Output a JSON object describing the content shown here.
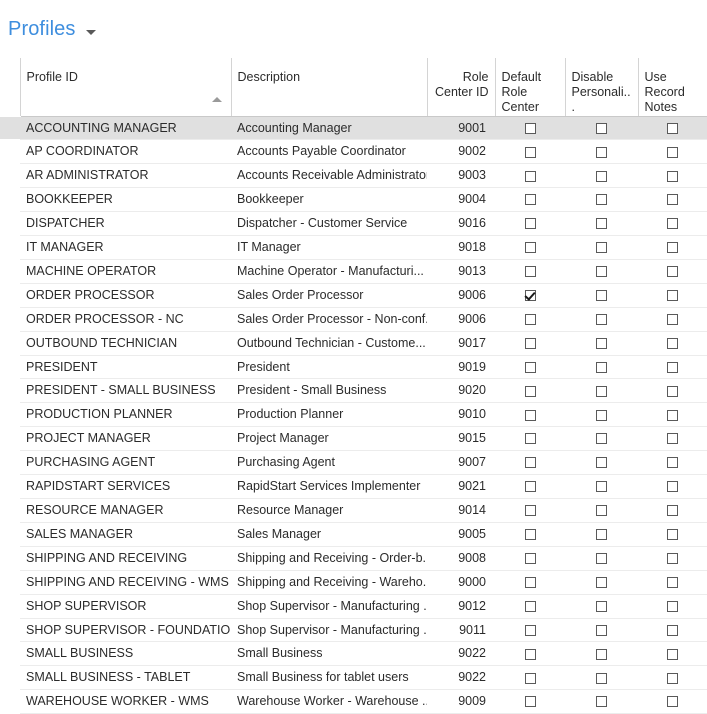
{
  "page": {
    "title": "Profiles",
    "caret_icon": "chevron-down-icon",
    "accent_color": "#3e8ede",
    "selected_row_color": "#e0e0e0",
    "row_divider_color": "#ececec"
  },
  "grid": {
    "sort": {
      "column": "Profile ID",
      "direction": "ascending",
      "icon": "sort-ascending-icon"
    },
    "columns": [
      {
        "key": "profile_id",
        "label": "Profile ID",
        "align": "left"
      },
      {
        "key": "description",
        "label": "Description",
        "align": "left"
      },
      {
        "key": "role_center_id",
        "label": "Role Center ID",
        "align": "right"
      },
      {
        "key": "default_role_center",
        "label": "Default Role Center",
        "align": "center"
      },
      {
        "key": "disable_personalization",
        "label": "Disable Personali...",
        "align": "center"
      },
      {
        "key": "use_record_notes",
        "label": "Use Record Notes",
        "align": "center"
      }
    ],
    "rows": [
      {
        "profile_id": "ACCOUNTING MANAGER",
        "description": "Accounting Manager",
        "role_center_id": "9001",
        "default_role_center": false,
        "disable_personalization": false,
        "use_record_notes": false,
        "selected": true
      },
      {
        "profile_id": "AP COORDINATOR",
        "description": "Accounts Payable Coordinator",
        "role_center_id": "9002",
        "default_role_center": false,
        "disable_personalization": false,
        "use_record_notes": false,
        "selected": false
      },
      {
        "profile_id": "AR ADMINISTRATOR",
        "description": "Accounts Receivable Administrator",
        "role_center_id": "9003",
        "default_role_center": false,
        "disable_personalization": false,
        "use_record_notes": false,
        "selected": false
      },
      {
        "profile_id": "BOOKKEEPER",
        "description": "Bookkeeper",
        "role_center_id": "9004",
        "default_role_center": false,
        "disable_personalization": false,
        "use_record_notes": false,
        "selected": false
      },
      {
        "profile_id": "DISPATCHER",
        "description": "Dispatcher - Customer Service",
        "role_center_id": "9016",
        "default_role_center": false,
        "disable_personalization": false,
        "use_record_notes": false,
        "selected": false
      },
      {
        "profile_id": "IT MANAGER",
        "description": "IT Manager",
        "role_center_id": "9018",
        "default_role_center": false,
        "disable_personalization": false,
        "use_record_notes": false,
        "selected": false
      },
      {
        "profile_id": "MACHINE OPERATOR",
        "description": "Machine Operator - Manufacturi...",
        "role_center_id": "9013",
        "default_role_center": false,
        "disable_personalization": false,
        "use_record_notes": false,
        "selected": false
      },
      {
        "profile_id": "ORDER PROCESSOR",
        "description": "Sales Order Processor",
        "role_center_id": "9006",
        "default_role_center": true,
        "disable_personalization": false,
        "use_record_notes": false,
        "selected": false
      },
      {
        "profile_id": "ORDER PROCESSOR - NC",
        "description": "Sales Order Processor - Non-conf...",
        "role_center_id": "9006",
        "default_role_center": false,
        "disable_personalization": false,
        "use_record_notes": false,
        "selected": false
      },
      {
        "profile_id": "OUTBOUND TECHNICIAN",
        "description": "Outbound Technician - Custome...",
        "role_center_id": "9017",
        "default_role_center": false,
        "disable_personalization": false,
        "use_record_notes": false,
        "selected": false
      },
      {
        "profile_id": "PRESIDENT",
        "description": "President",
        "role_center_id": "9019",
        "default_role_center": false,
        "disable_personalization": false,
        "use_record_notes": false,
        "selected": false
      },
      {
        "profile_id": "PRESIDENT - SMALL BUSINESS",
        "description": "President - Small Business",
        "role_center_id": "9020",
        "default_role_center": false,
        "disable_personalization": false,
        "use_record_notes": false,
        "selected": false
      },
      {
        "profile_id": "PRODUCTION PLANNER",
        "description": "Production Planner",
        "role_center_id": "9010",
        "default_role_center": false,
        "disable_personalization": false,
        "use_record_notes": false,
        "selected": false
      },
      {
        "profile_id": "PROJECT MANAGER",
        "description": "Project Manager",
        "role_center_id": "9015",
        "default_role_center": false,
        "disable_personalization": false,
        "use_record_notes": false,
        "selected": false
      },
      {
        "profile_id": "PURCHASING AGENT",
        "description": "Purchasing Agent",
        "role_center_id": "9007",
        "default_role_center": false,
        "disable_personalization": false,
        "use_record_notes": false,
        "selected": false
      },
      {
        "profile_id": "RAPIDSTART SERVICES",
        "description": "RapidStart Services Implementer",
        "role_center_id": "9021",
        "default_role_center": false,
        "disable_personalization": false,
        "use_record_notes": false,
        "selected": false
      },
      {
        "profile_id": "RESOURCE MANAGER",
        "description": "Resource Manager",
        "role_center_id": "9014",
        "default_role_center": false,
        "disable_personalization": false,
        "use_record_notes": false,
        "selected": false
      },
      {
        "profile_id": "SALES MANAGER",
        "description": "Sales Manager",
        "role_center_id": "9005",
        "default_role_center": false,
        "disable_personalization": false,
        "use_record_notes": false,
        "selected": false
      },
      {
        "profile_id": "SHIPPING AND RECEIVING",
        "description": "Shipping and Receiving - Order-b...",
        "role_center_id": "9008",
        "default_role_center": false,
        "disable_personalization": false,
        "use_record_notes": false,
        "selected": false
      },
      {
        "profile_id": "SHIPPING AND RECEIVING - WMS",
        "description": "Shipping and Receiving - Wareho...",
        "role_center_id": "9000",
        "default_role_center": false,
        "disable_personalization": false,
        "use_record_notes": false,
        "selected": false
      },
      {
        "profile_id": "SHOP SUPERVISOR",
        "description": "Shop Supervisor - Manufacturing ...",
        "role_center_id": "9012",
        "default_role_center": false,
        "disable_personalization": false,
        "use_record_notes": false,
        "selected": false
      },
      {
        "profile_id": "SHOP SUPERVISOR - FOUNDATION",
        "description": "Shop Supervisor - Manufacturing ...",
        "role_center_id": "9011",
        "default_role_center": false,
        "disable_personalization": false,
        "use_record_notes": false,
        "selected": false
      },
      {
        "profile_id": "SMALL BUSINESS",
        "description": "Small Business",
        "role_center_id": "9022",
        "default_role_center": false,
        "disable_personalization": false,
        "use_record_notes": false,
        "selected": false
      },
      {
        "profile_id": "SMALL BUSINESS - TABLET",
        "description": "Small Business for tablet users",
        "role_center_id": "9022",
        "default_role_center": false,
        "disable_personalization": false,
        "use_record_notes": false,
        "selected": false
      },
      {
        "profile_id": "WAREHOUSE WORKER - WMS",
        "description": "Warehouse Worker - Warehouse ...",
        "role_center_id": "9009",
        "default_role_center": false,
        "disable_personalization": false,
        "use_record_notes": false,
        "selected": false
      }
    ]
  }
}
